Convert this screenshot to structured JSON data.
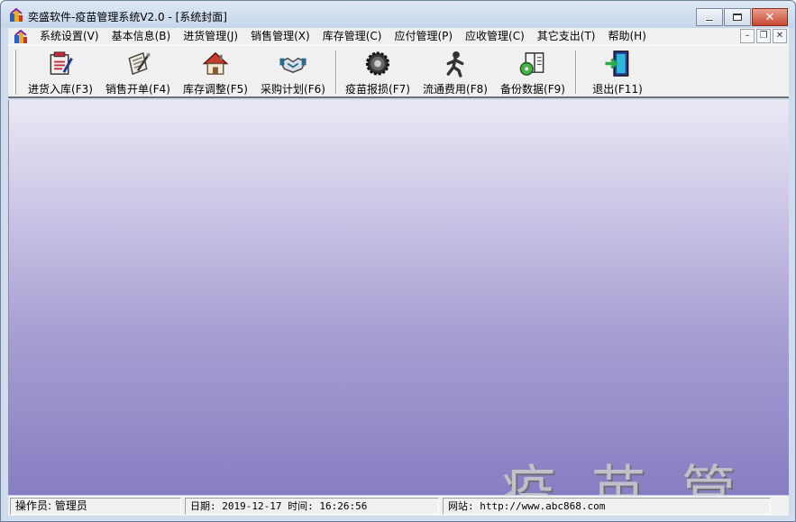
{
  "window": {
    "title": "奕盛软件-疫苗管理系统V2.0 - [系统封面]"
  },
  "menubar": {
    "items": [
      {
        "label": "系统设置(V)"
      },
      {
        "label": "基本信息(B)"
      },
      {
        "label": "进货管理(J)"
      },
      {
        "label": "销售管理(X)"
      },
      {
        "label": "库存管理(C)"
      },
      {
        "label": "应付管理(P)"
      },
      {
        "label": "应收管理(C)"
      },
      {
        "label": "其它支出(T)"
      },
      {
        "label": "帮助(H)"
      }
    ]
  },
  "toolbar": {
    "buttons": [
      {
        "label": "进货入库(F3)",
        "icon": "inbound-icon"
      },
      {
        "label": "销售开单(F4)",
        "icon": "sales-order-icon"
      },
      {
        "label": "库存调整(F5)",
        "icon": "house-icon"
      },
      {
        "label": "采购计划(F6)",
        "icon": "handshake-icon"
      },
      {
        "label": "疫苗报损(F7)",
        "icon": "gear-icon"
      },
      {
        "label": "流通费用(F8)",
        "icon": "running-man-icon"
      },
      {
        "label": "备份数据(F9)",
        "icon": "book-disc-icon"
      },
      {
        "label": "退出(F11)",
        "icon": "exit-door-icon"
      }
    ]
  },
  "splash": {
    "text": "疫苗管"
  },
  "statusbar": {
    "operator": "操作员: 管理员",
    "datetime": "日期: 2019-12-17  时间: 16:26:56",
    "website": "网站: http://www.abc868.com"
  },
  "colors": {
    "titlebar": "#cfdcec",
    "client_top": "#ebe8f5",
    "client_bottom": "#877dc2",
    "close_button": "#c7482f"
  }
}
